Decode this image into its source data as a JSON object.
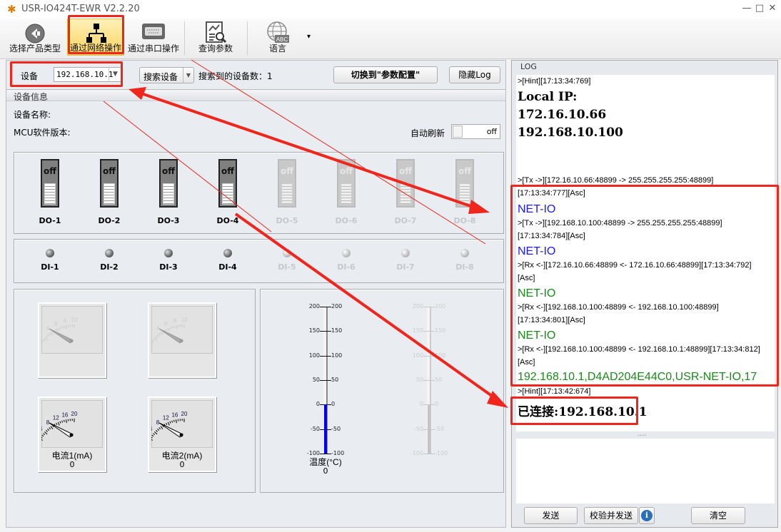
{
  "window": {
    "title": "USR-IO424T-EWR V2.2.20",
    "minimize": "—",
    "maximize": "□",
    "close": "✕"
  },
  "toolbar": {
    "items": [
      {
        "label": "选择产品类型",
        "icon": "back-arrow-icon"
      },
      {
        "label": "通过网络操作",
        "icon": "network-icon",
        "active": true
      },
      {
        "label": "通过串口操作",
        "icon": "serial-port-icon"
      },
      {
        "label": "查询参数",
        "icon": "query-params-icon"
      },
      {
        "label": "语言",
        "icon": "language-globe-icon",
        "badge": "ABC"
      }
    ],
    "more": "▾"
  },
  "device_bar": {
    "device_label": "设备",
    "device_value": "192.168.10.1",
    "search_label": "搜索设备",
    "found_label": "搜索到的设备数：1",
    "switch_label": "切换到\"参数配置\"",
    "hide_log_label": "隐藏Log"
  },
  "device_info": {
    "header": "设备信息",
    "name_label": "设备名称:",
    "mcu_label": "MCU软件版本:",
    "auto_refresh_label": "自动刷新",
    "auto_refresh_state": "off"
  },
  "do": {
    "state_text": "off",
    "items": [
      {
        "label": "DO-1",
        "enabled": true
      },
      {
        "label": "DO-2",
        "enabled": true
      },
      {
        "label": "DO-3",
        "enabled": true
      },
      {
        "label": "DO-4",
        "enabled": true
      },
      {
        "label": "DO-5",
        "enabled": false
      },
      {
        "label": "DO-6",
        "enabled": false
      },
      {
        "label": "DO-7",
        "enabled": false
      },
      {
        "label": "DO-8",
        "enabled": false
      }
    ]
  },
  "di": {
    "items": [
      {
        "label": "DI-1",
        "enabled": true
      },
      {
        "label": "DI-2",
        "enabled": true
      },
      {
        "label": "DI-3",
        "enabled": true
      },
      {
        "label": "DI-4",
        "enabled": true
      },
      {
        "label": "DI-5",
        "enabled": false
      },
      {
        "label": "DI-6",
        "enabled": false
      },
      {
        "label": "DI-7",
        "enabled": false
      },
      {
        "label": "DI-8",
        "enabled": false
      }
    ]
  },
  "gauges": [
    {
      "ticks": [
        "0",
        "2",
        "4",
        "6",
        "8",
        "10"
      ],
      "enabled": false,
      "label": "",
      "value": ""
    },
    {
      "ticks": [
        "0",
        "2",
        "4",
        "6",
        "8",
        "10"
      ],
      "enabled": false,
      "label": "",
      "value": ""
    },
    {
      "ticks": [
        "0",
        "4",
        "8",
        "12",
        "16",
        "20"
      ],
      "enabled": true,
      "label": "电流1(mA)",
      "value": "0"
    },
    {
      "ticks": [
        "0",
        "4",
        "8",
        "12",
        "16",
        "20"
      ],
      "enabled": true,
      "label": "电流2(mA)",
      "value": "0"
    }
  ],
  "thermometers": [
    {
      "ticks": [
        "200",
        "150",
        "100",
        "50",
        "0",
        "-50",
        "-100"
      ],
      "enabled": true,
      "label": "温度(°C)",
      "value": "0",
      "fill_color": "#0000ff"
    },
    {
      "ticks": [
        "200",
        "150",
        "100",
        "50",
        "0",
        "-50",
        "-100"
      ],
      "enabled": false,
      "label": "",
      "value": "",
      "fill_color": "#c4c4c4"
    }
  ],
  "log": {
    "header": "LOG",
    "splitter": "....",
    "lines": [
      {
        "text": ">[Hint][17:13:34:769]",
        "style": "s",
        "color": "#000000"
      },
      {
        "text": "Local IP:",
        "style": "b",
        "color": "#000000"
      },
      {
        "text": "172.16.10.66",
        "style": "b",
        "color": "#000000"
      },
      {
        "text": "192.168.10.100",
        "style": "b",
        "color": "#000000"
      },
      {
        "text": ">[Tx ->][172.16.10.66:48899 -> 255.255.255.255:48899]",
        "style": "s",
        "color": "#000000"
      },
      {
        "text": "[17:13:34:777][Asc]",
        "style": "s",
        "color": "#000000"
      },
      {
        "text": "NET-IO",
        "style": "n",
        "color": "#1a1aff"
      },
      {
        "text": ">[Tx ->][192.168.10.100:48899 -> 255.255.255.255:48899]",
        "style": "s",
        "color": "#000000"
      },
      {
        "text": "[17:13:34:784][Asc]",
        "style": "s",
        "color": "#000000"
      },
      {
        "text": "NET-IO",
        "style": "n",
        "color": "#1a1aff"
      },
      {
        "text": ">[Rx <-][172.16.10.66:48899 <- 172.16.10.66:48899][17:13:34:792]",
        "style": "s",
        "color": "#000000"
      },
      {
        "text": "[Asc]",
        "style": "s",
        "color": "#000000"
      },
      {
        "text": "NET-IO",
        "style": "n",
        "color": "#1a8a1a"
      },
      {
        "text": ">[Rx <-][192.168.10.100:48899 <- 192.168.10.100:48899]",
        "style": "s",
        "color": "#000000"
      },
      {
        "text": "[17:13:34:801][Asc]",
        "style": "s",
        "color": "#000000"
      },
      {
        "text": "NET-IO",
        "style": "n",
        "color": "#1a8a1a"
      },
      {
        "text": ">[Rx <-][192.168.10.100:48899 <- 192.168.10.1:48899][17:13:34:812]",
        "style": "s",
        "color": "#000000"
      },
      {
        "text": "[Asc]",
        "style": "s",
        "color": "#000000"
      },
      {
        "text": "192.168.10.1,D4AD204E44C0,USR-NET-IO,17",
        "style": "n",
        "color": "#1a8a1a"
      },
      {
        "text": ">[Hint][17:13:42:674]",
        "style": "s",
        "color": "#000000"
      },
      {
        "text": "已连接:192.168.10.1",
        "style": "b",
        "color": "#000000"
      }
    ]
  },
  "log_buttons": {
    "send": "发送",
    "verify_send": "校验并发送",
    "info": "i",
    "clear": "清空"
  },
  "colors": {
    "annotation_red": "#f0261c",
    "active_tool": "#fbd35e",
    "info_blue": "#2a6ebf"
  }
}
